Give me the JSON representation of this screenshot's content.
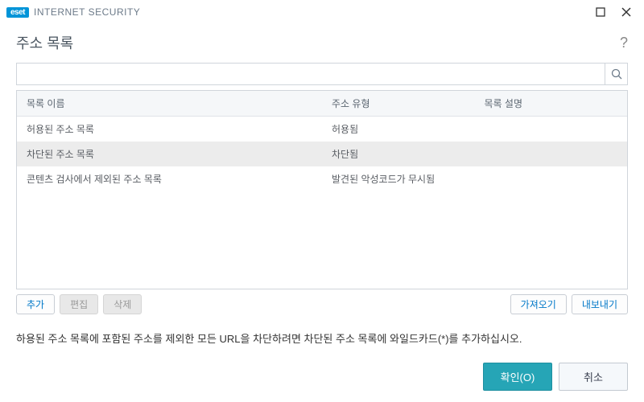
{
  "titlebar": {
    "logo_text": "eset",
    "product_name": "INTERNET SECURITY"
  },
  "header": {
    "title": "주소 목록"
  },
  "search": {
    "value": ""
  },
  "table": {
    "columns": [
      "목록 이름",
      "주소 유형",
      "목록 설명"
    ],
    "rows": [
      {
        "name": "허용된 주소 목록",
        "type": "허용됨",
        "desc": "",
        "selected": false
      },
      {
        "name": "차단된 주소 목록",
        "type": "차단됨",
        "desc": "",
        "selected": true
      },
      {
        "name": "콘텐츠 검사에서 제외된 주소 목록",
        "type": "발견된 악성코드가 무시됨",
        "desc": "",
        "selected": false
      }
    ]
  },
  "actions": {
    "add": "추가",
    "edit": "편집",
    "delete": "삭제",
    "import": "가져오기",
    "export": "내보내기"
  },
  "hint": "하용된 주소 목록에 포함된 주소를 제외한 모든 URL을 차단하려면 차단된 주소 목록에 와일드카드(*)를 추가하십시오.",
  "footer": {
    "ok": "확인(O)",
    "cancel": "취소"
  }
}
